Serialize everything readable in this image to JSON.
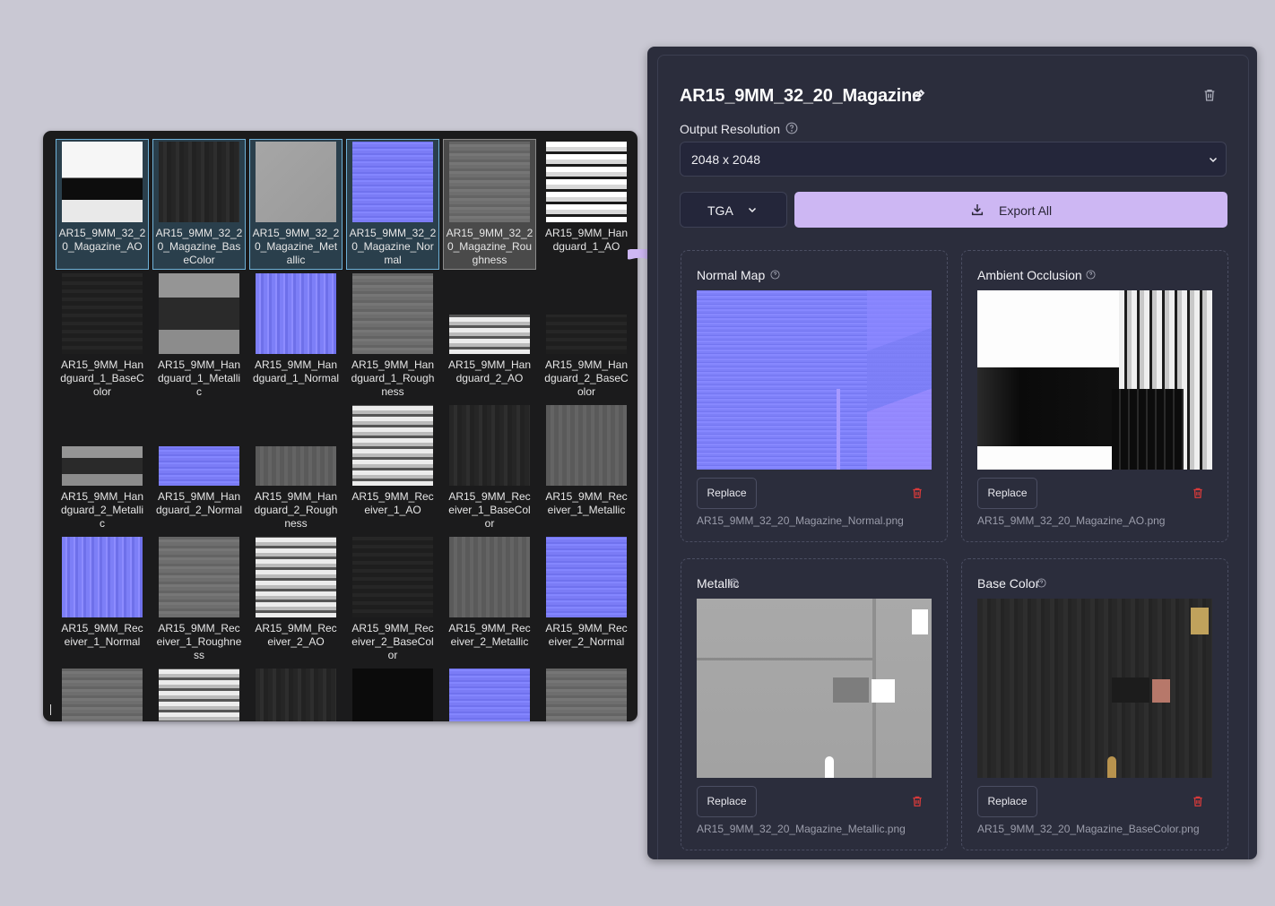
{
  "browser": {
    "items": [
      {
        "name": "AR15_9MM_32_20_Magazine_AO",
        "tex": "tx-ao",
        "sel": "blue"
      },
      {
        "name": "AR15_9MM_32_20_Magazine_BaseColor",
        "tex": "tx-dark",
        "sel": "blue"
      },
      {
        "name": "AR15_9MM_32_20_Magazine_Metallic",
        "tex": "tx-grey",
        "sel": "blue"
      },
      {
        "name": "AR15_9MM_32_20_Magazine_Normal",
        "tex": "tx-normal",
        "sel": "blue"
      },
      {
        "name": "AR15_9MM_32_20_Magazine_Roughness",
        "tex": "tx-rough",
        "sel": "grey"
      },
      {
        "name": "AR15_9MM_Handguard_1_AO",
        "tex": "tx-ao2",
        "sel": ""
      },
      {
        "name": "AR15_9MM_Handguard_1_BaseColor",
        "tex": "tx-darker",
        "sel": ""
      },
      {
        "name": "AR15_9MM_Handguard_1_Metallic",
        "tex": "tx-metal",
        "sel": ""
      },
      {
        "name": "AR15_9MM_Handguard_1_Normal",
        "tex": "tx-normal2",
        "sel": ""
      },
      {
        "name": "AR15_9MM_Handguard_1_Roughness",
        "tex": "tx-rough",
        "sel": ""
      },
      {
        "name": "AR15_9MM_Handguard_2_AO",
        "tex": "tx-bw",
        "sel": "",
        "short": true
      },
      {
        "name": "AR15_9MM_Handguard_2_BaseColor",
        "tex": "tx-darker",
        "sel": "",
        "short": true
      },
      {
        "name": "AR15_9MM_Handguard_2_Metallic",
        "tex": "tx-metal",
        "sel": "",
        "short": true
      },
      {
        "name": "AR15_9MM_Handguard_2_Normal",
        "tex": "tx-normal",
        "sel": "",
        "short": true
      },
      {
        "name": "AR15_9MM_Handguard_2_Roughness",
        "tex": "tx-midgrey",
        "sel": "",
        "short": true
      },
      {
        "name": "AR15_9MM_Receiver_1_AO",
        "tex": "tx-bw",
        "sel": ""
      },
      {
        "name": "AR15_9MM_Receiver_1_BaseColor",
        "tex": "tx-dark",
        "sel": ""
      },
      {
        "name": "AR15_9MM_Receiver_1_Metallic",
        "tex": "tx-midgrey",
        "sel": ""
      },
      {
        "name": "AR15_9MM_Receiver_1_Normal",
        "tex": "tx-normal2",
        "sel": ""
      },
      {
        "name": "AR15_9MM_Receiver_1_Roughness",
        "tex": "tx-rough",
        "sel": ""
      },
      {
        "name": "AR15_9MM_Receiver_2_AO",
        "tex": "tx-bw",
        "sel": ""
      },
      {
        "name": "AR15_9MM_Receiver_2_BaseColor",
        "tex": "tx-darker",
        "sel": ""
      },
      {
        "name": "AR15_9MM_Receiver_2_Metallic",
        "tex": "tx-midgrey",
        "sel": ""
      },
      {
        "name": "AR15_9MM_Receiver_2_Normal",
        "tex": "tx-normal",
        "sel": ""
      },
      {
        "name": "",
        "tex": "tx-rough",
        "sel": ""
      },
      {
        "name": "",
        "tex": "tx-bw",
        "sel": ""
      },
      {
        "name": "",
        "tex": "tx-dark",
        "sel": ""
      },
      {
        "name": "",
        "tex": "tx-black",
        "sel": ""
      },
      {
        "name": "",
        "tex": "tx-normal",
        "sel": ""
      },
      {
        "name": "",
        "tex": "tx-rough",
        "sel": ""
      }
    ]
  },
  "panel": {
    "title": "AR15_9MM_32_20_Magazine",
    "resolution_label": "Output Resolution",
    "resolution_value": "2048 x 2048",
    "format_value": "TGA",
    "export_label": "Export All",
    "accent": "#cdb7f3",
    "delete_color": "#d93a3a"
  },
  "cards": [
    {
      "title": "Normal Map",
      "replace": "Replace",
      "file": "AR15_9MM_32_20_Magazine_Normal.png",
      "tex": "big-normal"
    },
    {
      "title": "Ambient Occlusion",
      "replace": "Replace",
      "file": "AR15_9MM_32_20_Magazine_AO.png",
      "tex": "big-ao"
    },
    {
      "title": "Metallic",
      "replace": "Replace",
      "file": "AR15_9MM_32_20_Magazine_Metallic.png",
      "tex": "big-metal"
    },
    {
      "title": "Base Color",
      "replace": "Replace",
      "file": "AR15_9MM_32_20_Magazine_BaseColor.png",
      "tex": "big-base"
    }
  ]
}
